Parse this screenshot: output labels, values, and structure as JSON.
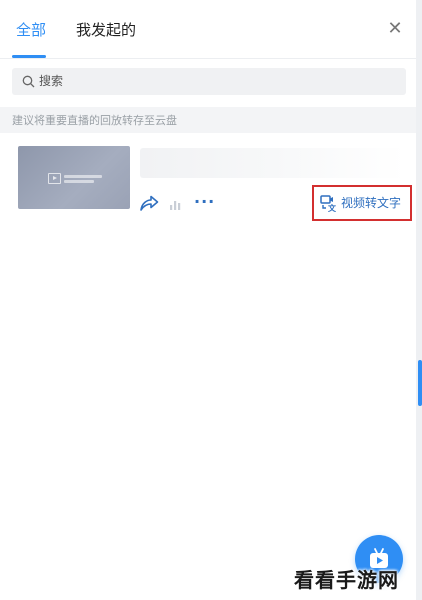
{
  "tabs": {
    "all": "全部",
    "mine": "我发起的"
  },
  "search": {
    "placeholder": "搜索"
  },
  "tip": "建议将重要直播的回放转存至云盘",
  "card": {
    "convert_label": "视频转文字"
  },
  "watermark": "看看手游网",
  "icons": {
    "close": "close-icon",
    "search": "search-icon",
    "share": "share-icon",
    "stats": "bar-chart-icon",
    "more": "more-icon",
    "convert": "video-to-text-icon",
    "fab": "live-tv-icon"
  },
  "colors": {
    "accent": "#2f8ef4",
    "highlight_box": "#d32f2f",
    "link": "#2f6fbf"
  }
}
